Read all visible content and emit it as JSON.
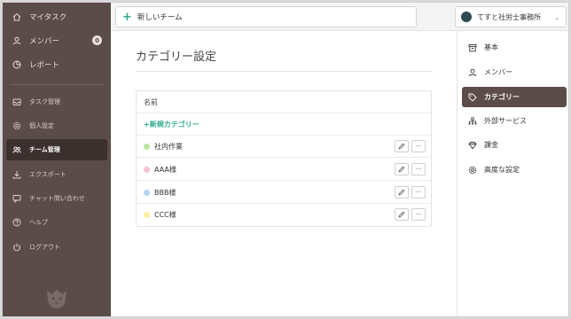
{
  "sidebar": {
    "items": [
      {
        "label": "マイタスク",
        "icon": "home-icon"
      },
      {
        "label": "メンバー",
        "icon": "person-icon",
        "badge": "0"
      },
      {
        "label": "レポート",
        "icon": "report-icon"
      },
      {
        "label": "タスク管理",
        "icon": "inbox-icon"
      },
      {
        "label": "個人設定",
        "icon": "gear-icon"
      },
      {
        "label": "チーム管理",
        "icon": "team-icon"
      },
      {
        "label": "エクスポート",
        "icon": "download-icon"
      },
      {
        "label": "チャット問い合わせ",
        "icon": "chat-icon"
      },
      {
        "label": "ヘルプ",
        "icon": "help-icon"
      },
      {
        "label": "ログアウト",
        "icon": "power-icon"
      }
    ],
    "active_index": 5
  },
  "topbar": {
    "new_team_label": "新しいチーム",
    "team_name": "てすと社労士事務所"
  },
  "main": {
    "page_title": "カテゴリー設定",
    "table_header": "名前",
    "add_category_label": "+新規カテゴリー",
    "categories": [
      {
        "name": "社内作業",
        "color": "#b8e6a0"
      },
      {
        "name": "AAA様",
        "color": "#f7c1cf"
      },
      {
        "name": "BBB様",
        "color": "#b6d4f2"
      },
      {
        "name": "CCC様",
        "color": "#fbf0a0"
      }
    ],
    "more_glyph": "···"
  },
  "settings_menu": {
    "items": [
      {
        "label": "基本",
        "icon": "box-icon"
      },
      {
        "label": "メンバー",
        "icon": "person-icon"
      },
      {
        "label": "カテゴリー",
        "icon": "tag-icon"
      },
      {
        "label": "外部サービス",
        "icon": "network-icon"
      },
      {
        "label": "課金",
        "icon": "diamond-icon"
      },
      {
        "label": "高度な設定",
        "icon": "gear-icon"
      }
    ],
    "active_index": 2
  },
  "colors": {
    "sidebar_bg": "#5b4b49",
    "accent_green": "#2faa8e",
    "active_bg": "#3d312f"
  }
}
